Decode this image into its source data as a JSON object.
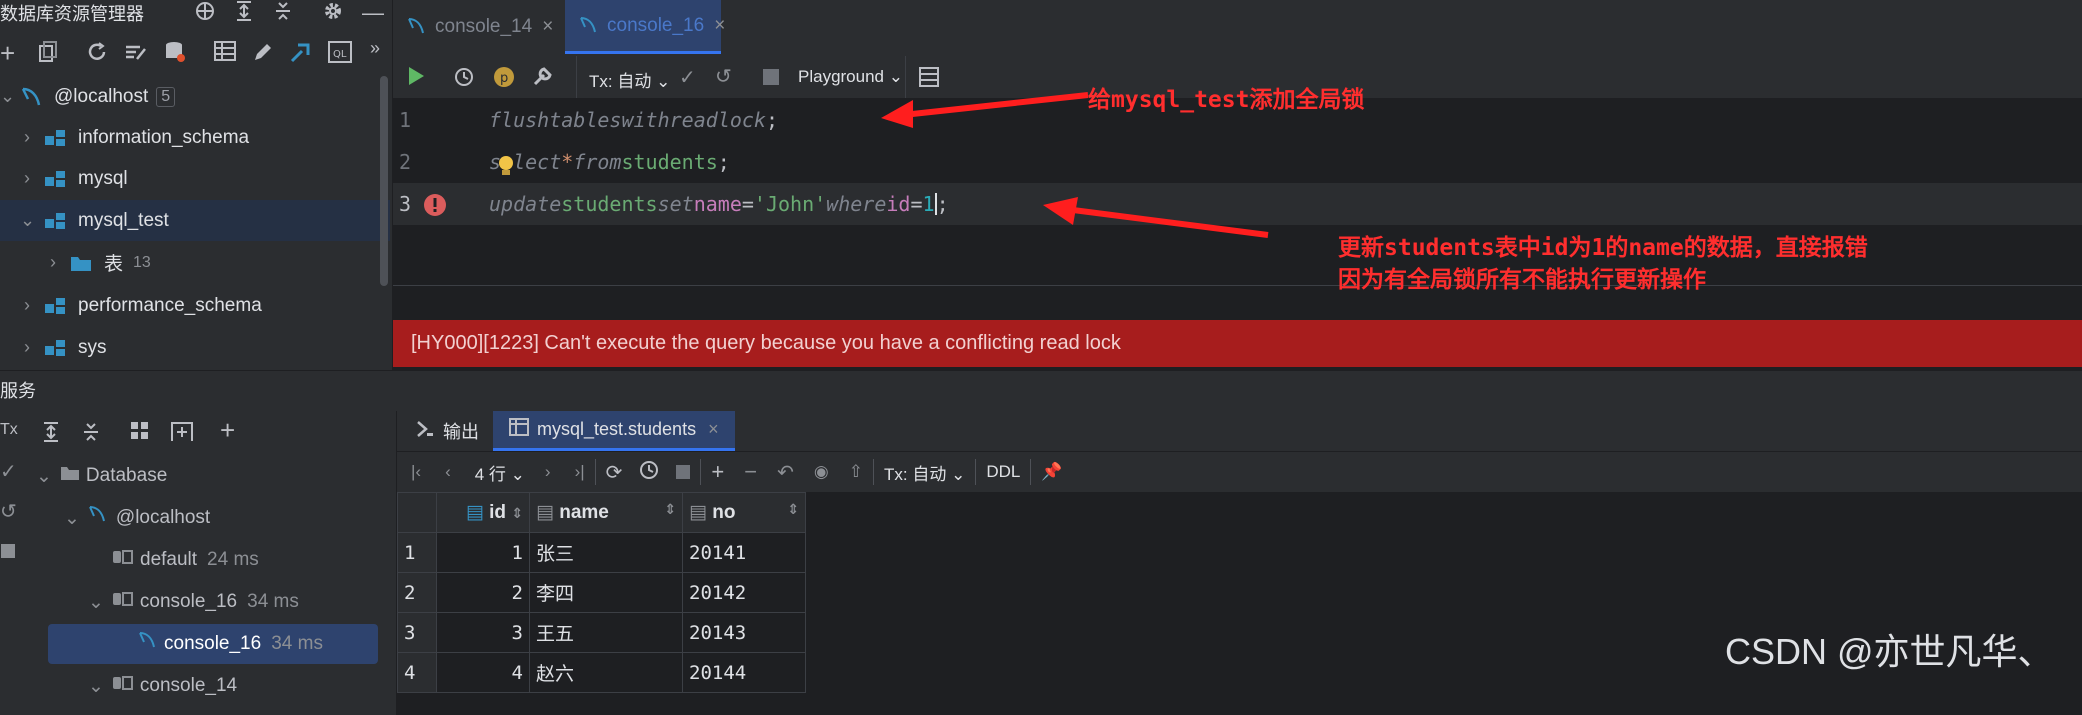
{
  "explorer": {
    "title": "数据库资源管理器",
    "host": {
      "label": "@localhost",
      "count": "5"
    },
    "schemas": [
      {
        "label": "information_schema"
      },
      {
        "label": "mysql"
      },
      {
        "label": "mysql_test"
      },
      {
        "label": "performance_schema"
      },
      {
        "label": "sys"
      }
    ],
    "tables_folder": {
      "label": "表",
      "count": "13"
    }
  },
  "editor": {
    "tabs": [
      "console_14",
      "console_16"
    ],
    "toolbar": {
      "tx": "Tx: 自动",
      "playground": "Playground"
    },
    "lines": [
      {
        "num": "1",
        "tokens": [
          "flush",
          " tables ",
          "with",
          " read ",
          "lock",
          ";"
        ]
      },
      {
        "num": "2",
        "tokens": [
          "select",
          " * ",
          "from",
          " students",
          ";"
        ]
      },
      {
        "num": "3",
        "tokens": [
          "update",
          " students ",
          "set",
          " name ",
          "=",
          " 'John' ",
          "where",
          " id ",
          "=",
          " 1",
          ";"
        ]
      }
    ],
    "error": "[HY000][1223] Can't execute the query because you have a conflicting read lock",
    "annotations": {
      "a1": "给mysql_test添加全局锁",
      "a2_line1": "更新students表中id为1的name的数据，直接报错",
      "a2_line2": "因为有全局锁所有不能执行更新操作"
    }
  },
  "services": {
    "title": "服务",
    "tree": {
      "database": "Database",
      "host": "@localhost",
      "default": {
        "label": "default",
        "ms": "24 ms"
      },
      "console16": {
        "label": "console_16",
        "ms": "34 ms"
      },
      "console16_child": {
        "label": "console_16",
        "ms": "34 ms"
      },
      "console14": {
        "label": "console_14"
      }
    },
    "result_tabs": [
      "输出",
      "mysql_test.students"
    ],
    "result_toolbar": {
      "rows": "4 行",
      "tx": "Tx: 自动",
      "ddl": "DDL"
    },
    "table": {
      "columns": [
        "id",
        "name",
        "no"
      ],
      "rows": [
        {
          "rn": "1",
          "id": "1",
          "name": "张三",
          "no": "20141"
        },
        {
          "rn": "2",
          "id": "2",
          "name": "李四",
          "no": "20142"
        },
        {
          "rn": "3",
          "id": "3",
          "name": "王五",
          "no": "20143"
        },
        {
          "rn": "4",
          "id": "4",
          "name": "赵六",
          "no": "20144"
        }
      ]
    }
  },
  "watermark": "CSDN @亦世凡华、",
  "colors": {
    "accent": "#3574f0",
    "error_bg": "#a71d1d",
    "annotation": "#ff2e2e"
  }
}
